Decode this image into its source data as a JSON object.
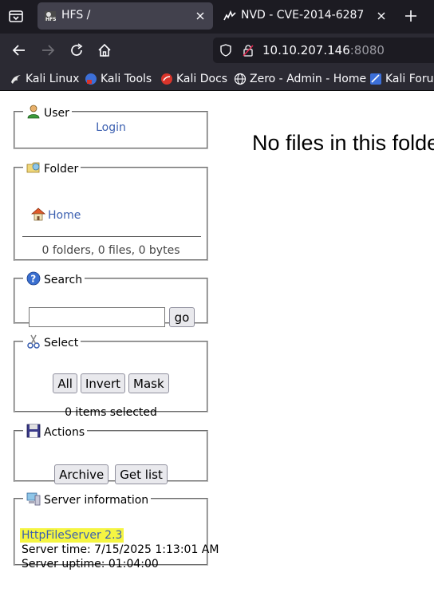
{
  "browser": {
    "tabs": [
      {
        "title": "HFS /",
        "favicon": "hfs-favicon",
        "active": true
      },
      {
        "title": "NVD - CVE-2014-6287",
        "favicon": "nvd-favicon",
        "active": false
      }
    ],
    "url": {
      "host": "10.10.207.146",
      "port": ":8080"
    },
    "bookmarks": [
      {
        "label": "Kali Linux",
        "icon": "kali-dragon-icon"
      },
      {
        "label": "Kali Tools",
        "icon": "kali-tools-icon"
      },
      {
        "label": "Kali Docs",
        "icon": "kali-docs-icon"
      },
      {
        "label": "Zero - Admin - Home",
        "icon": "globe-icon"
      },
      {
        "label": "Kali Forums",
        "icon": "kali-forums-icon"
      }
    ]
  },
  "sidebar": {
    "user": {
      "legend": "User",
      "login_link": "Login"
    },
    "folder": {
      "legend": "Folder",
      "home_link": "Home",
      "summary": "0 folders, 0 files, 0 bytes"
    },
    "search": {
      "legend": "Search",
      "input_value": "",
      "go_label": "go"
    },
    "select": {
      "legend": "Select",
      "all_label": "All",
      "invert_label": "Invert",
      "mask_label": "Mask",
      "status": "0 items selected"
    },
    "actions": {
      "legend": "Actions",
      "archive_label": "Archive",
      "getlist_label": "Get list"
    },
    "server": {
      "legend": "Server information",
      "version_link": "HttpFileServer 2.3",
      "server_time": "Server time: 7/15/2025 1:13:01 AM",
      "server_uptime": "Server uptime: 01:04:00"
    }
  },
  "main": {
    "message": "No files in this folder"
  },
  "colors": {
    "tab_bar": "#1c1b22",
    "toolbar": "#2b2a33",
    "active_tab": "#42414d",
    "link": "#3b5fb0",
    "highlight": "#f5f542"
  }
}
